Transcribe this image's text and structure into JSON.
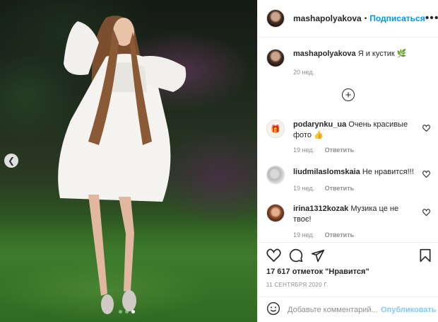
{
  "post": {
    "author": "mashapolyakova",
    "follow_label": "Подписаться",
    "separator": "•",
    "more_icon": "more-horizontal-icon",
    "caption_text": "Я и кустик",
    "caption_emoji": "🌿",
    "caption_time": "20 нед.",
    "load_more_icon": "plus-circle-icon"
  },
  "carousel": {
    "dot_count": 3,
    "active_dot": 2
  },
  "comments": [
    {
      "username": "podarynku_ua",
      "text": "Очень красивые фото 👍",
      "time": "19 нед.",
      "reply": "Ответить",
      "avatar_text": "🎁"
    },
    {
      "username": "liudmilaslomskaia",
      "text": "Не нравится!!!",
      "time": "19 нед.",
      "reply": "Ответить"
    },
    {
      "username": "irina1312kozak",
      "text": "Музика це не твоє!",
      "time": "19 нед.",
      "reply": "Ответить"
    }
  ],
  "actions": {
    "icons": [
      "heart-icon",
      "comment-icon",
      "share-icon",
      "bookmark-icon"
    ],
    "likes": "17 617 отметок \"Нравится\"",
    "date": "11 СЕНТЯБРЯ 2020 Г."
  },
  "add_comment": {
    "placeholder": "Добавьте комментарий...",
    "post_label": "Опубликовать"
  },
  "colors": {
    "accent": "#0095f6",
    "muted": "#8e8e8e",
    "text": "#262626",
    "border": "#efefef"
  }
}
